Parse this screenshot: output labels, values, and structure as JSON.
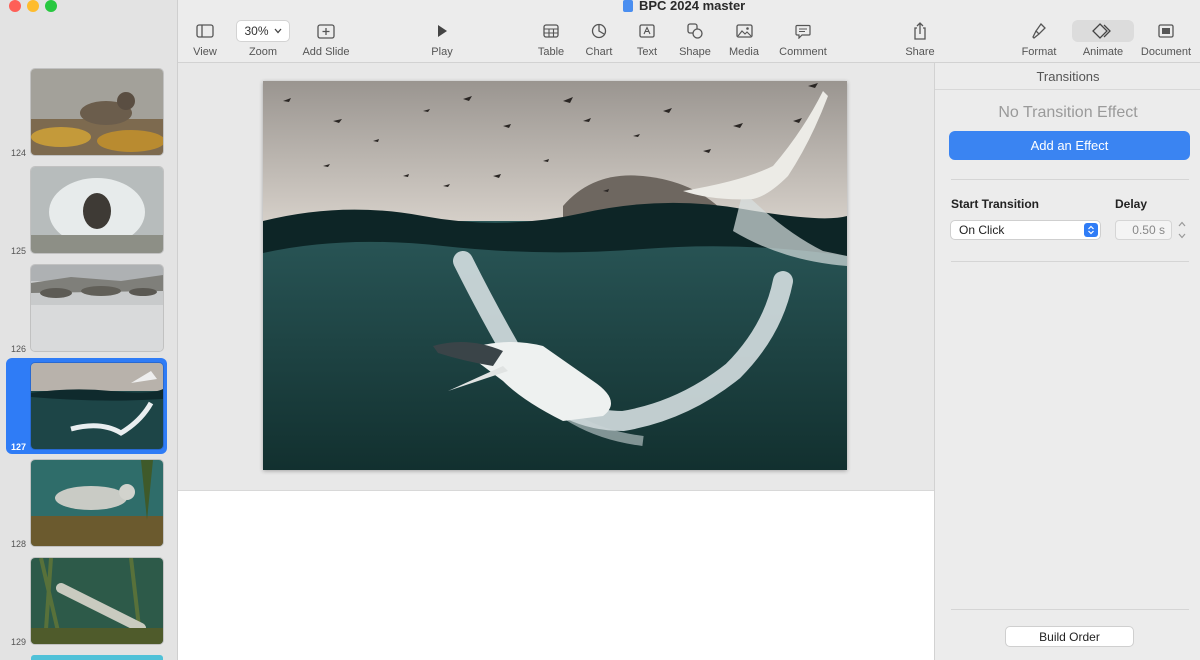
{
  "window": {
    "title": "BPC 2024 master"
  },
  "toolbar": {
    "view_label": "View",
    "zoom_value": "30%",
    "zoom_label": "Zoom",
    "add_slide_label": "Add Slide",
    "play_label": "Play",
    "table_label": "Table",
    "chart_label": "Chart",
    "text_label": "Text",
    "shape_label": "Shape",
    "media_label": "Media",
    "comment_label": "Comment",
    "share_label": "Share",
    "format_label": "Format",
    "animate_label": "Animate",
    "document_label": "Document"
  },
  "sidebar": {
    "slides": [
      {
        "number": "124"
      },
      {
        "number": "125"
      },
      {
        "number": "126"
      },
      {
        "number": "127",
        "selected": true
      },
      {
        "number": "128"
      },
      {
        "number": "129"
      }
    ]
  },
  "inspector": {
    "tab": "Transitions",
    "no_effect": "No Transition Effect",
    "add_effect_label": "Add an Effect",
    "start_transition_label": "Start Transition",
    "start_transition_value": "On Click",
    "delay_label": "Delay",
    "delay_value": "0.50 s",
    "build_order_label": "Build Order"
  },
  "colors": {
    "accent": "#2f7cf6",
    "add_effect_button": "#3a84f2"
  }
}
